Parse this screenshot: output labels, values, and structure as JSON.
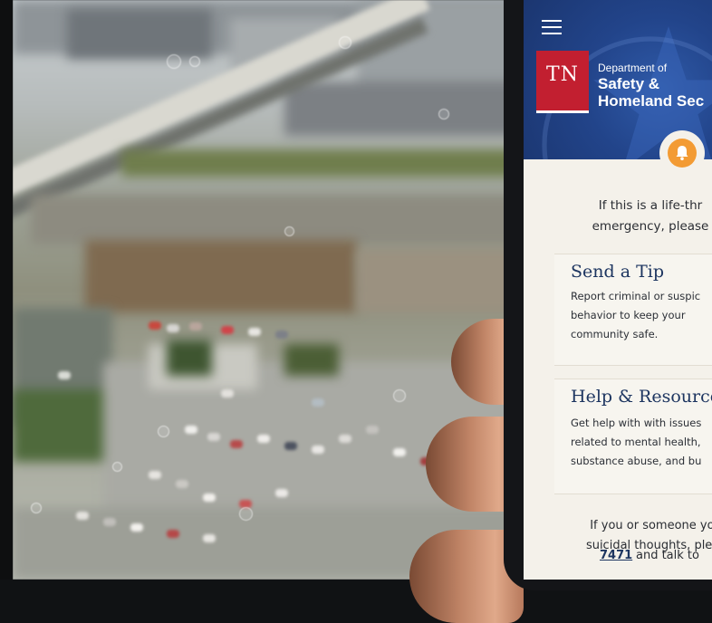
{
  "header": {
    "menu_icon": "hamburger-menu-icon",
    "logo_text": "TN",
    "department_line1": "Department of",
    "department_line2": "Safety &",
    "department_line3": "Homeland Sec"
  },
  "alert": {
    "icon": "bell-icon",
    "accent_color": "#f39b33",
    "line1": "If this is a life-thr",
    "line2": "emergency, please"
  },
  "cards": [
    {
      "title": "Send a Tip",
      "description": "Report criminal or suspic\nbehavior to keep your\ncommunity safe."
    },
    {
      "title": "Help & Resources",
      "description": "Get help with with issues\nrelated to mental health,\nsubstance abuse, and bu"
    }
  ],
  "crisis": {
    "line1": "If you or someone you",
    "line2": "suicidal thoughts, pleas",
    "link": "7471",
    "tail": "and talk to"
  },
  "colors": {
    "brand_red": "#c21f30",
    "header_blue": "#22448a",
    "title_navy": "#1d3560",
    "content_bg": "#f4f1ea"
  }
}
